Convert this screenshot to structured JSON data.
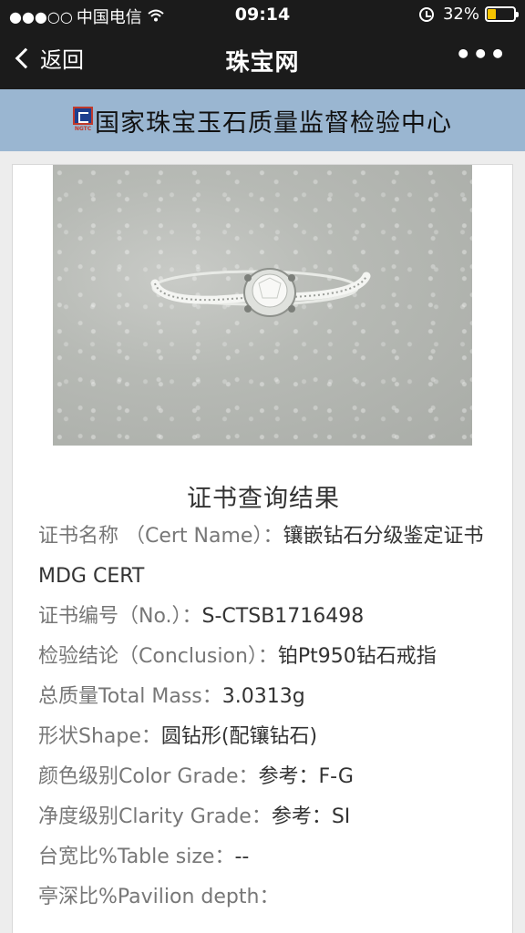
{
  "status_bar": {
    "signal": "●●●○○",
    "carrier": "中国电信",
    "time": "09:14",
    "battery": "32%",
    "battery_level": 0.32,
    "battery_color": "#f5c400"
  },
  "nav": {
    "back_label": "返回",
    "title": "珠宝网",
    "more_label": "•••"
  },
  "banner": {
    "logo_text": "NGTC",
    "title": "国家珠宝玉石质量监督检验中心",
    "background": "#9ab6d1"
  },
  "result": {
    "heading": "证书查询结果",
    "rows": [
      {
        "label": "证书名称 （Cert Name）：",
        "value": "镶嵌钻石分级鉴定证书MDG CERT"
      },
      {
        "label": "证书编号（No.）：",
        "value": "S-CTSB1716498"
      },
      {
        "label": "检验结论（Conclusion）：",
        "value": "铂Pt950钻石戒指"
      },
      {
        "label": "总质量Total Mass：",
        "value": "3.0313g"
      },
      {
        "label": "形状Shape：",
        "value": "圆钻形(配镶钻石)"
      },
      {
        "label": "颜色级别Color Grade：",
        "value": "参考：F-G"
      },
      {
        "label": "净度级别Clarity Grade：",
        "value": "参考：SI"
      },
      {
        "label": "台宽比%Table size：",
        "value": "--"
      },
      {
        "label": "亭深比%Pavilion depth：",
        "value": ""
      }
    ]
  }
}
